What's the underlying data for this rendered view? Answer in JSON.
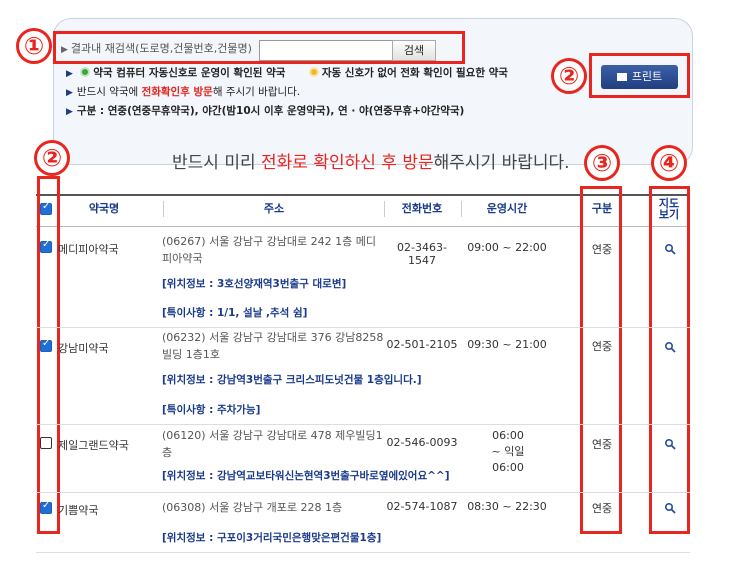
{
  "search": {
    "label": "결과내 재검색(도로명,건물번호,건물명)",
    "value": "",
    "button": "검색"
  },
  "legend": {
    "green_text": "약국 컴퓨터 자동신호로 운영이 확인된 약국",
    "yellow_text": "자동 신호가 없어 전화 확인이 필요한 약국",
    "line2_pre": "반드시 약국에 ",
    "line2_red": "전화확인후 방문",
    "line2_post": "해 주시기 바랍니다.",
    "line3": "구분 : 연중(연중무휴약국), 야간(밤10시 이후 운영약국), 연 · 야(연중무휴+야간약국)"
  },
  "print_button": "프린트",
  "headline": {
    "pre": "반드시 미리 ",
    "red1": "전화로",
    "mid": " ",
    "red2": "확인하신 후 방문",
    "post": "해주시기 바랍니다."
  },
  "callouts": [
    "①",
    "②",
    "②",
    "③",
    "④"
  ],
  "table": {
    "headers": {
      "name": "약국명",
      "address": "주소",
      "phone": "전화번호",
      "hours": "운영시간",
      "type": "구분",
      "map_line1": "지도",
      "map_line2": "보기"
    },
    "rows": [
      {
        "checked": true,
        "name": "메디피아약국",
        "address": "(06267) 서울 강남구 강남대로 242 1층 메디피아약국",
        "info": "[위치정보 : 3호선양재역3번출구 대로변]",
        "note": "[특이사항 : 1/1, 설날 ,추석 쉼]",
        "phone": "02-3463-1547",
        "hours": "09:00 ~ 22:00",
        "type": "연중"
      },
      {
        "checked": true,
        "name": "강남미약국",
        "address": "(06232) 서울 강남구 강남대로 376 강남8258빌딩 1층1호",
        "info": "[위치정보 : 강남역3번출구 크리스피도넛건물 1층입니다.]",
        "note": "[특이사항 : 주차가능]",
        "phone": "02-501-2105",
        "hours": "09:30 ~ 21:00",
        "type": "연중"
      },
      {
        "checked": false,
        "name": "제일그랜드약국",
        "address": "(06120) 서울 강남구 강남대로 478 제우빌딩1층",
        "info": "[위치정보 : 강남역교보타워신논현역3번출구바로옆에있어요^^]",
        "note": "",
        "phone": "02-546-0093",
        "hours": "06:00 ~ 익일 06:00",
        "type": "연중"
      },
      {
        "checked": true,
        "name": "기쁨약국",
        "address": "(06308) 서울 강남구 개포로 228 1층",
        "info": "[위치정보 : 구포이3거리국민은행맞은편건물1층]",
        "note": "",
        "phone": "02-574-1087",
        "hours": "08:30 ~ 22:30",
        "type": "연중"
      }
    ]
  }
}
